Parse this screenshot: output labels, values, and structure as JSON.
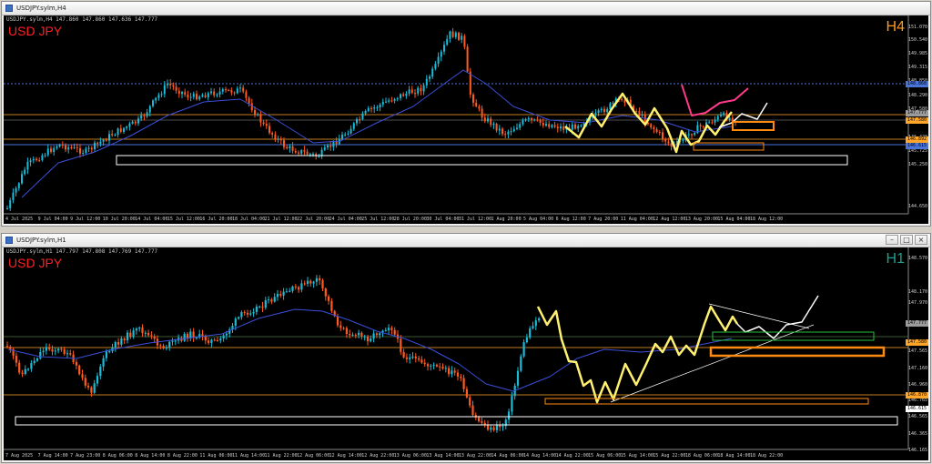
{
  "top": {
    "title": "USDJPY.sylm,H4",
    "info": "USDJPY.sylm,H4  147.860 147.860 147.636 147.777",
    "symbol": "USD JPY",
    "timeframe": "H4",
    "timeframe_color": "#ff9a1f",
    "y_ticks": [
      "151.070",
      "150.540",
      "149.985",
      "149.315",
      "148.850",
      "148.290",
      "147.580",
      "147.205",
      "146.420",
      "145.725",
      "145.250",
      "144.650"
    ],
    "x_ticks": [
      "4 Jul 2025",
      "9 Jul 04:00",
      "9 Jul 12:00",
      "10 Jul 20:00",
      "14 Jul 04:00",
      "15 Jul 12:00",
      "16 Jul 20:00",
      "18 Jul 04:00",
      "21 Jul 12:00",
      "22 Jul 20:00",
      "24 Jul 04:00",
      "25 Jul 12:00",
      "28 Jul 20:00",
      "30 Jul 04:00",
      "31 Jul 12:00",
      "1 Aug 20:00",
      "5 Aug 04:00",
      "6 Aug 12:00",
      "7 Aug 20:00",
      "11 Aug 04:00",
      "12 Aug 12:00",
      "13 Aug 20:00",
      "15 Aug 04:00",
      "18 Aug 12:00"
    ],
    "badges": [
      {
        "text": "148.868",
        "bg": "#4a74d8"
      },
      {
        "text": "147.777",
        "bg": "#9b9b9b"
      },
      {
        "text": "147.580",
        "bg": "#ffa52a"
      },
      {
        "text": "146.892",
        "bg": "#ffa52a"
      },
      {
        "text": "146.615",
        "bg": "#4a74d8"
      }
    ]
  },
  "bottom": {
    "title": "USDJPY.sylm,H1",
    "info": "USDJPY.sylm,H1  147.797 147.808 147.769 147.777",
    "symbol": "USD JPY",
    "timeframe": "H1",
    "timeframe_color": "#1fa090",
    "y_ticks": [
      "148.570",
      "148.170",
      "147.970",
      "147.565",
      "147.160",
      "146.960",
      "146.765",
      "146.565",
      "146.365",
      "146.165"
    ],
    "x_ticks": [
      "7 Aug 2025",
      "7 Aug 14:00",
      "7 Aug 23:00",
      "8 Aug 06:00",
      "8 Aug 14:00",
      "8 Aug 22:00",
      "11 Aug 06:00",
      "11 Aug 14:00",
      "11 Aug 22:00",
      "12 Aug 06:00",
      "12 Aug 14:00",
      "12 Aug 22:00",
      "13 Aug 06:00",
      "13 Aug 14:00",
      "13 Aug 22:00",
      "14 Aug 06:00",
      "14 Aug 14:00",
      "14 Aug 22:00",
      "15 Aug 06:00",
      "15 Aug 14:00",
      "15 Aug 22:00",
      "18 Aug 06:00",
      "18 Aug 14:00",
      "18 Aug 22:00"
    ],
    "badges": [
      {
        "text": "147.777",
        "bg": "#9b9b9b"
      },
      {
        "text": "147.580",
        "bg": "#ffa52a"
      },
      {
        "text": "146.870",
        "bg": "#ffa52a"
      },
      {
        "text": "146.615",
        "bg": "#ffffff"
      }
    ]
  },
  "colors": {
    "bull": "#19bcd8",
    "bear": "#ff5a1f",
    "ma": "#3a4fd8",
    "orange": "#ff8a10",
    "yellow": "#fff070",
    "pink": "#ff3a8a"
  }
}
